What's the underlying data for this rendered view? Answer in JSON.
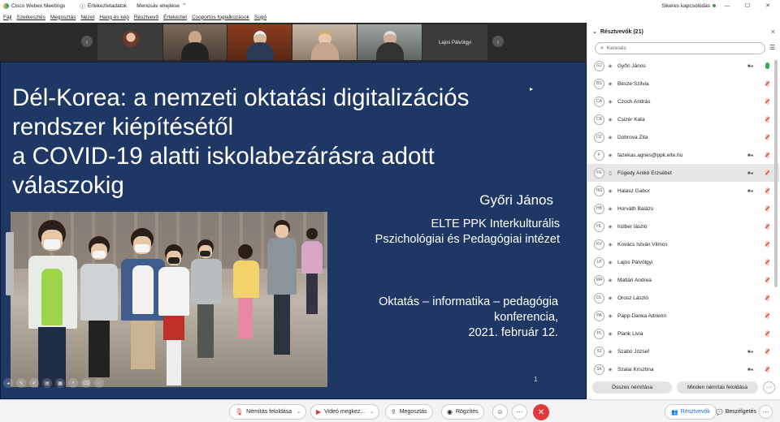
{
  "window": {
    "app_title": "Cisco Webex Meetings",
    "session_info": "Értekezletadatok",
    "hide_menu": "Menüsáv elrejtése",
    "connection_status": "Sikeres kapcsolódás",
    "win_minimize": "—",
    "win_maximize": "☐",
    "win_close": "✕"
  },
  "menu": [
    "Fájl",
    "Szerkesztés",
    "Megosztás",
    "Nézet",
    "Hang és kép",
    "Résztvevő",
    "Értekezlet",
    "Csoportos foglalkozások",
    "Súgó"
  ],
  "filmstrip": {
    "tiles": [
      {
        "type": "avatar",
        "name": ""
      },
      {
        "type": "video",
        "name": ""
      },
      {
        "type": "video",
        "name": ""
      },
      {
        "type": "video",
        "name": ""
      },
      {
        "type": "video",
        "name": ""
      },
      {
        "type": "name",
        "name": "Lajos Pálvölgyi"
      }
    ]
  },
  "slide": {
    "title_lines": [
      "Dél-Korea: a nemzeti oktatási digitalizációs",
      "rendszer kiépítésétől",
      "a COVID-19 alatti iskolabezárásra adott",
      "válaszokig"
    ],
    "author": "Győri János",
    "institution_lines": [
      "ELTE PPK Interkulturális",
      "Pszichológiai és Pedagógiai intézet"
    ],
    "conference_lines": [
      "Oktatás – informatika – pedagógia",
      "konferencia,",
      "2021. február 12."
    ],
    "page_number": "1"
  },
  "participants_panel": {
    "title": "Résztvevők (21)",
    "search_placeholder": "Keresés",
    "mute_all": "Összes némítása",
    "unmute_all": "Minden némítás feloldása",
    "more": "···",
    "participants": [
      {
        "initials": "GJ",
        "name": "Győri János",
        "video": true,
        "mic": "on",
        "selected": false
      },
      {
        "initials": "BS",
        "name": "Besze Szilvia",
        "video": false,
        "mic": "muted",
        "selected": false
      },
      {
        "initials": "CA",
        "name": "Czoch András",
        "video": false,
        "mic": "muted",
        "selected": false
      },
      {
        "initials": "CK",
        "name": "Csizér Kata",
        "video": false,
        "mic": "muted",
        "selected": false
      },
      {
        "initials": "DZ",
        "name": "Dobrova Zita",
        "video": false,
        "mic": "muted",
        "selected": false
      },
      {
        "initials": "F",
        "name": "fazekas.agnes@ppk.elte.hu",
        "video": true,
        "mic": "muted",
        "selected": false
      },
      {
        "initials": "FE",
        "name": "Fügedy Anikó Erzsébet",
        "video": true,
        "mic": "muted",
        "selected": true,
        "device": "mobile"
      },
      {
        "initials": "HG",
        "name": "Halasz Gabor",
        "video": true,
        "mic": "muted",
        "selected": false
      },
      {
        "initials": "HB",
        "name": "Horváth Balázs",
        "video": false,
        "mic": "muted",
        "selected": false
      },
      {
        "initials": "HL",
        "name": "hülber lászló",
        "video": false,
        "mic": "muted",
        "selected": false
      },
      {
        "initials": "KV",
        "name": "Kovács István Vilmos",
        "video": false,
        "mic": "muted",
        "selected": false
      },
      {
        "initials": "LP",
        "name": "Lajos Pálvölgyi",
        "video": false,
        "mic": "muted",
        "selected": false
      },
      {
        "initials": "MA",
        "name": "Matlári Andrea",
        "video": false,
        "mic": "muted",
        "selected": false
      },
      {
        "initials": "OL",
        "name": "Orosz László",
        "video": false,
        "mic": "muted",
        "selected": false
      },
      {
        "initials": "PA",
        "name": "Papp-Danka Adrienn",
        "video": false,
        "mic": "muted",
        "selected": false
      },
      {
        "initials": "PL",
        "name": "Plank Livia",
        "video": false,
        "mic": "muted",
        "selected": false
      },
      {
        "initials": "SJ",
        "name": "Szabó József",
        "video": true,
        "mic": "muted",
        "selected": false
      },
      {
        "initials": "SK",
        "name": "Szalai Krisztina",
        "video": true,
        "mic": "muted",
        "selected": false
      }
    ]
  },
  "controls": {
    "unmute": "Némítás feloldása",
    "stop_video": "Videó megkez...",
    "share": "Megosztás",
    "record": "Rögzítés",
    "more": "···",
    "participants_tab": "Résztvevők",
    "chat_tab": "Beszélgetés",
    "panel_more": "···"
  },
  "colors": {
    "slide_bg": "#1f3764",
    "end_call": "#e0393b",
    "accent": "#1a6fd6"
  }
}
